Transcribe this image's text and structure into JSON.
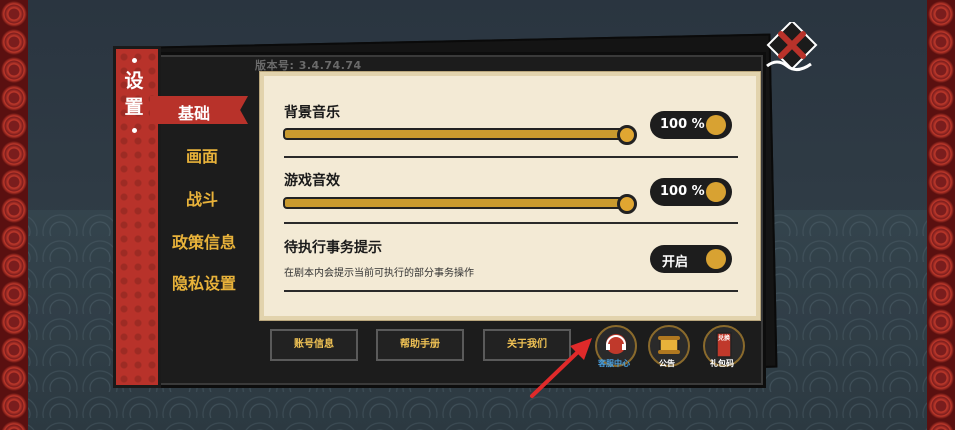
{
  "version_text": "版本号: 3.4.74.74",
  "panel_title": [
    "设",
    "置"
  ],
  "nav": {
    "items": [
      "基础",
      "画面",
      "战斗",
      "政策信息",
      "隐私设置"
    ],
    "active": "基础"
  },
  "settings": {
    "bgm": {
      "label": "背景音乐",
      "value": "100 %",
      "level": 1.0
    },
    "sfx": {
      "label": "游戏音效",
      "value": "100 %",
      "level": 1.0
    },
    "tips": {
      "label": "待执行事务提示",
      "desc": "在剧本内会提示当前可执行的部分事务操作",
      "state": "开启"
    }
  },
  "buttons": {
    "account": "账号信息",
    "help": "帮助手册",
    "about": "关于我们"
  },
  "icon_buttons": [
    {
      "label": "客服中心",
      "icon": "headset-icon",
      "color": "#4aa0e0"
    },
    {
      "label": "公告",
      "icon": "scroll-icon",
      "color": "#ffffff"
    },
    {
      "label": "礼包码",
      "icon": "gift-tag-icon",
      "color": "#ffffff",
      "tag": "兑换"
    }
  ],
  "colors": {
    "accent_red": "#b8322a",
    "gold": "#e8b23a",
    "arrow": "#e02a2a"
  }
}
